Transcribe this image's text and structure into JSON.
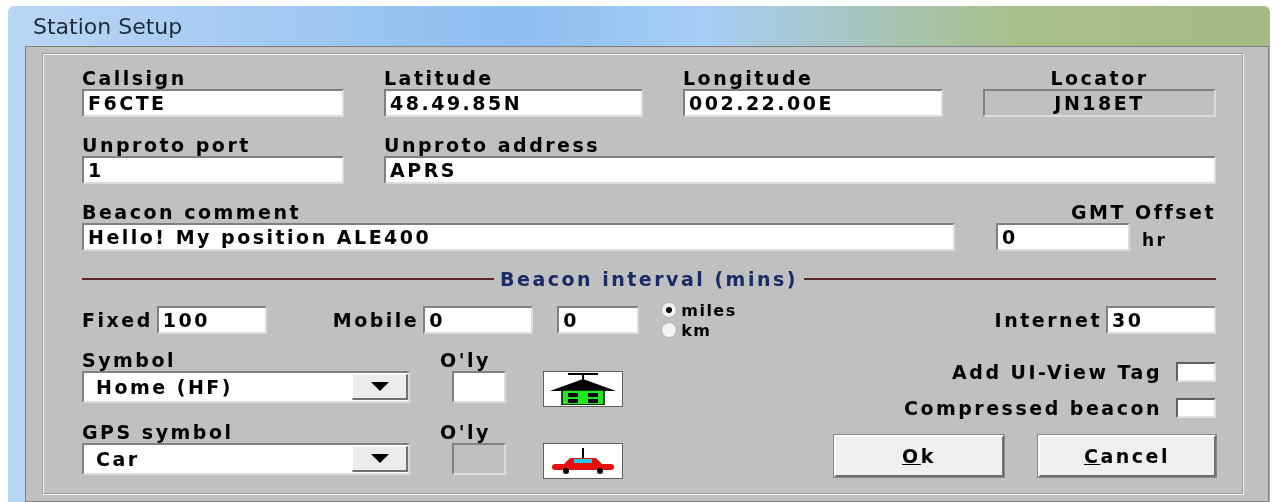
{
  "window": {
    "title": "Station Setup"
  },
  "callsign": {
    "label": "Callsign",
    "value": "F6CTE"
  },
  "latitude": {
    "label": "Latitude",
    "value": "48.49.85N"
  },
  "longitude": {
    "label": "Longitude",
    "value": "002.22.00E"
  },
  "locator": {
    "label": "Locator",
    "value": "JN18ET",
    "readonly": true
  },
  "unproto_port": {
    "label": "Unproto port",
    "value": "1"
  },
  "unproto_address": {
    "label": "Unproto address",
    "value": "APRS"
  },
  "beacon_comment": {
    "label": "Beacon comment",
    "value": "Hello! My position ALE400"
  },
  "gmt_offset": {
    "label": "GMT Offset",
    "value": "0",
    "unit": "hr"
  },
  "beacon_interval": {
    "title": "Beacon interval (mins)",
    "fixed": {
      "label": "Fixed",
      "value": "100"
    },
    "mobile": {
      "label": "Mobile",
      "values": [
        "0",
        "0"
      ]
    },
    "units": [
      {
        "label": "miles",
        "selected": true
      },
      {
        "label": "km",
        "selected": false
      }
    ],
    "internet": {
      "label": "Internet",
      "value": "30"
    }
  },
  "symbols": [
    {
      "label": "Symbol",
      "value": "Home (HF)",
      "overlay_label": "O'ly",
      "overlay_disabled": false,
      "kind": "house"
    },
    {
      "label": "GPS symbol",
      "value": "Car",
      "overlay_label": "O'ly",
      "overlay_disabled": true,
      "kind": "car"
    }
  ],
  "options": [
    {
      "label": "Add UI-View Tag",
      "checked": false
    },
    {
      "label": "Compressed beacon",
      "checked": false
    }
  ],
  "buttons": [
    {
      "label": "Ok",
      "underline_first": true
    },
    {
      "label": "Cancel",
      "underline_first": true
    }
  ]
}
